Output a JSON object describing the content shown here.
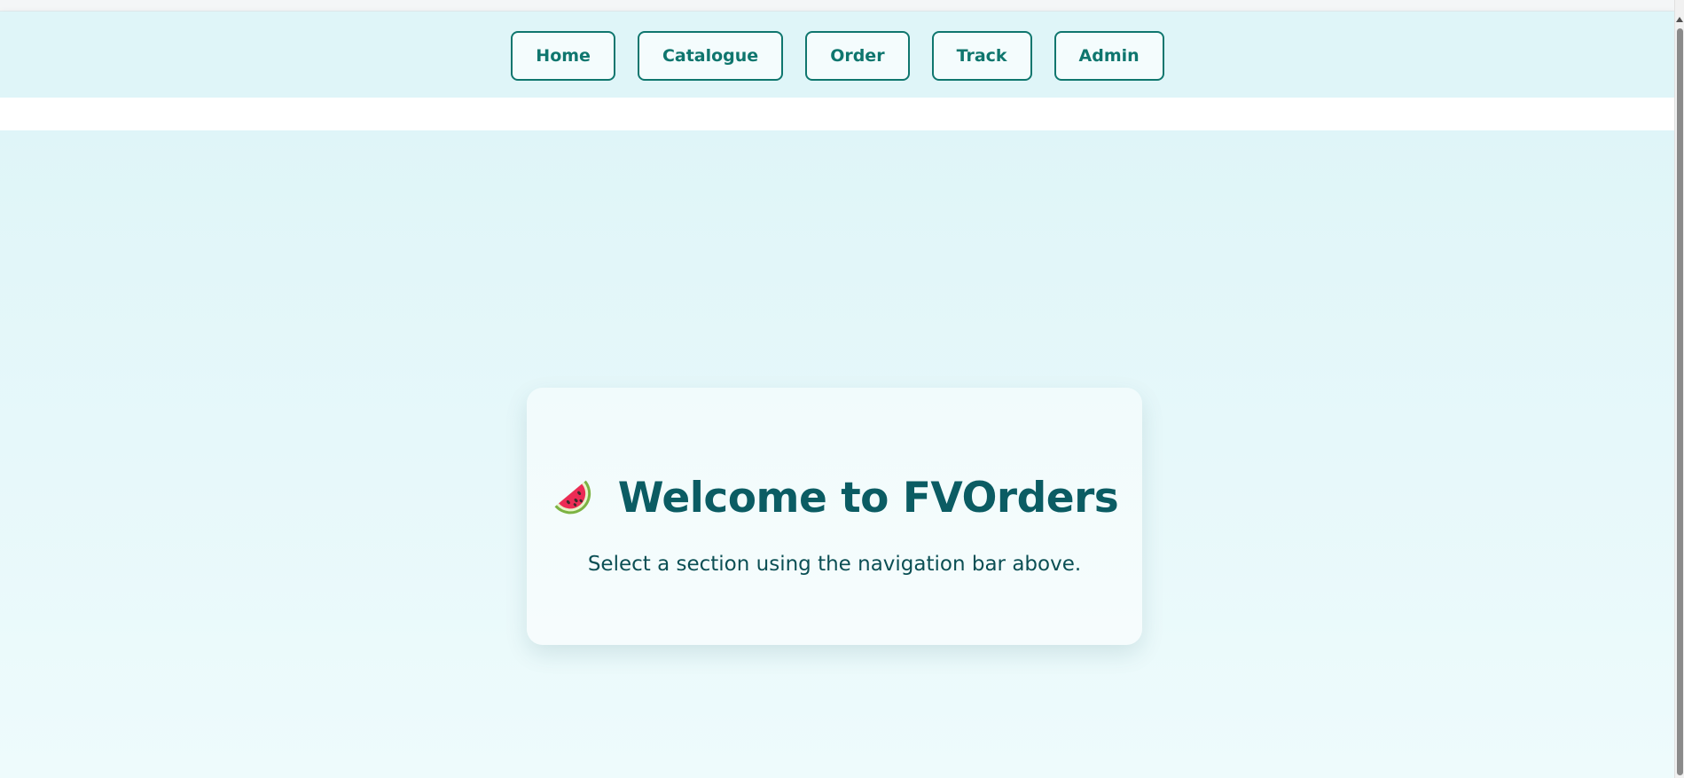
{
  "nav": {
    "items": [
      {
        "label": "Home"
      },
      {
        "label": "Catalogue"
      },
      {
        "label": "Order"
      },
      {
        "label": "Track"
      },
      {
        "label": "Admin"
      }
    ]
  },
  "welcome": {
    "icon": "watermelon-icon",
    "title": "Welcome to FVOrders",
    "subtitle": "Select a section using the navigation bar above."
  },
  "colors": {
    "accent": "#0f766e",
    "title": "#0b5c63",
    "nav_background": "#dff5f8",
    "page_background": "#e7f8fa"
  }
}
